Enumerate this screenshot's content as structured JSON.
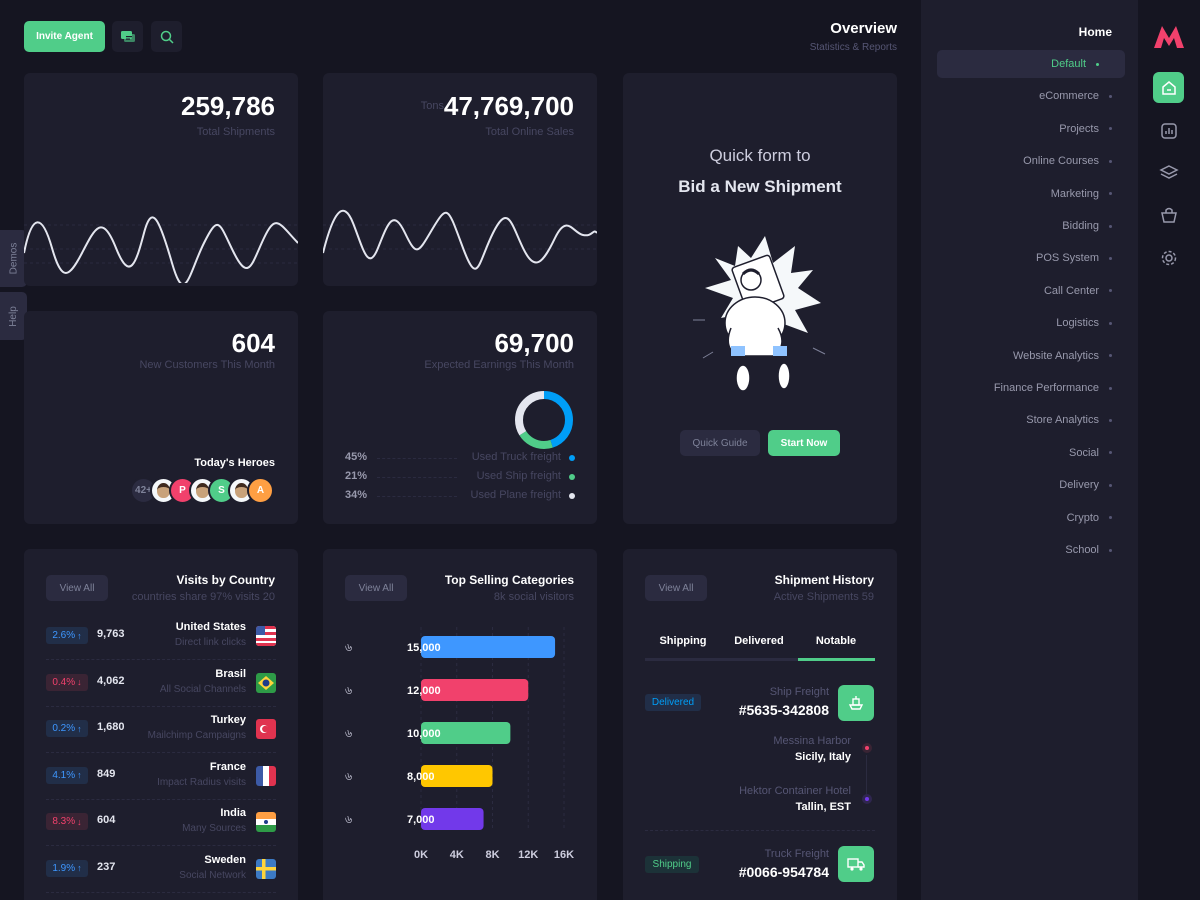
{
  "topbar": {
    "invite_label": "Invite Agent",
    "chat_icon": "chat-icon",
    "search_icon": "search-icon",
    "title": "Overview",
    "subtitle": "Statistics & Reports"
  },
  "sidetabs": {
    "demos": "Demos",
    "help": "Help"
  },
  "cards": {
    "shipments": {
      "value": "259,786",
      "label": "Total Shipments"
    },
    "sales": {
      "prefix": "Tons",
      "value": "47,769,700",
      "label": "Total Online Sales"
    },
    "customers": {
      "value": "604",
      "label": "New Customers This Month",
      "heroes_title": "Today's Heroes"
    },
    "earnings": {
      "value": "69,700",
      "label": "Expected Earnings This Month"
    }
  },
  "heroes": [
    {
      "label": "42+",
      "color": "#2b2b40",
      "text_color": "#7e8299"
    },
    {
      "label": "",
      "color": "#f5f8fa"
    },
    {
      "label": "P",
      "color": "#f1416c"
    },
    {
      "label": "",
      "color": "#f5f8fa"
    },
    {
      "label": "S",
      "color": "#50cd89"
    },
    {
      "label": "",
      "color": "#f5f8fa"
    },
    {
      "label": "A",
      "color": "#ff9f43"
    }
  ],
  "freight": [
    {
      "pct": "45%",
      "label": "Used Truck freight",
      "color": "#009ef7",
      "value": 45
    },
    {
      "pct": "21%",
      "label": "Used Ship freight",
      "color": "#50cd89",
      "value": 21
    },
    {
      "pct": "34%",
      "label": "Used Plane freight",
      "color": "#e4e6ef",
      "value": 34
    }
  ],
  "quickform": {
    "line1": "Quick form to",
    "line2": "Bid a New Shipment",
    "guide": "Quick Guide",
    "start": "Start Now"
  },
  "visits": {
    "title": "Visits by Country",
    "subtitle": "countries share 97% visits 20",
    "view_all": "View All",
    "rows": [
      {
        "pct": "2.6%",
        "dir": "up",
        "value": "9,763",
        "country": "United States",
        "source": "Direct link clicks",
        "flag": "us-flag"
      },
      {
        "pct": "0.4%",
        "dir": "down",
        "value": "4,062",
        "country": "Brasil",
        "source": "All Social Channels",
        "flag": "br-flag"
      },
      {
        "pct": "0.2%",
        "dir": "up",
        "value": "1,680",
        "country": "Turkey",
        "source": "Mailchimp Campaigns",
        "flag": "tr-flag"
      },
      {
        "pct": "4.1%",
        "dir": "up",
        "value": "849",
        "country": "France",
        "source": "Impact Radius visits",
        "flag": "fr-flag"
      },
      {
        "pct": "8.3%",
        "dir": "down",
        "value": "604",
        "country": "India",
        "source": "Many Sources",
        "flag": "in-flag"
      },
      {
        "pct": "1.9%",
        "dir": "up",
        "value": "237",
        "country": "Sweden",
        "source": "Social Network",
        "flag": "se-flag"
      }
    ]
  },
  "categories": {
    "title": "Top Selling Categories",
    "subtitle": "8k social visitors",
    "view_all": "View All"
  },
  "chart_data": {
    "type": "bar",
    "orientation": "horizontal",
    "categories": [
      "",
      "",
      "",
      "",
      ""
    ],
    "values": [
      15000,
      12000,
      10000,
      8000,
      7000
    ],
    "value_labels": [
      "15,000",
      "12,000",
      "10,000",
      "8,000",
      "7,000"
    ],
    "colors": [
      "#3e97ff",
      "#f1416c",
      "#50cd89",
      "#ffc700",
      "#7239ea"
    ],
    "x_ticks": [
      "0K",
      "4K",
      "8K",
      "12K",
      "16K"
    ],
    "xlim": [
      0,
      16000
    ]
  },
  "shipment": {
    "title": "Shipment History",
    "subtitle": "Active Shipments 59",
    "view_all": "View All",
    "tabs": [
      "Shipping",
      "Delivered",
      "Notable"
    ],
    "items": [
      {
        "status": "Delivered",
        "kind": "Ship Freight",
        "code": "#5635-342808",
        "icon": "ship-icon",
        "stops": [
          {
            "place": "Messina Harbor",
            "city": "Sicily, Italy"
          },
          {
            "place": "Hektor Container Hotel",
            "city": "Tallin, EST"
          }
        ]
      },
      {
        "status": "Shipping",
        "kind": "Truck Freight",
        "code": "#0066-954784",
        "icon": "truck-icon"
      }
    ]
  },
  "menu": {
    "heading": "Home",
    "items": [
      "Default",
      "eCommerce",
      "Projects",
      "Online Courses",
      "Marketing",
      "Bidding",
      "POS System",
      "Call Center",
      "Logistics",
      "Website Analytics",
      "Finance Performance",
      "Store Analytics",
      "Social",
      "Delivery",
      "Crypto",
      "School"
    ]
  },
  "colors": {
    "accent": "#50cd89",
    "card": "#1e1e2d",
    "bg": "#151521",
    "logo": "#f1416c"
  }
}
